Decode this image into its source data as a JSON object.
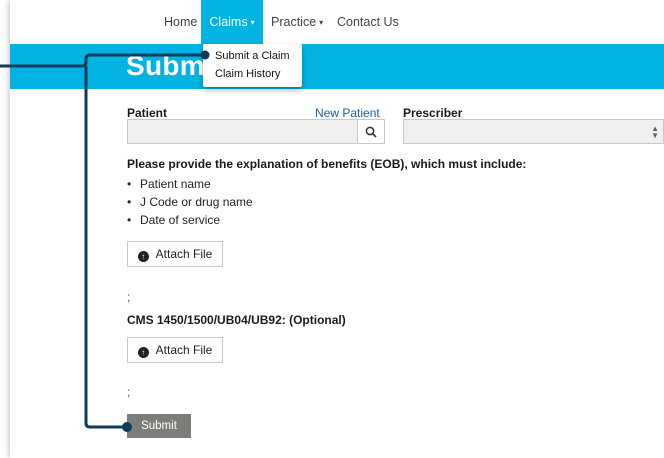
{
  "nav": {
    "home": "Home",
    "claims": "Claims",
    "practice": "Practice",
    "contact": "Contact Us",
    "caret": "▾"
  },
  "banner": {
    "title": "Submit"
  },
  "dropdown": {
    "items": [
      "Submit a Claim",
      "Claim History"
    ]
  },
  "form": {
    "patient_label": "Patient",
    "new_patient_link": "New Patient",
    "prescriber_label": "Prescriber",
    "eob_heading": "Please provide the explanation of benefits (EOB), which must include:",
    "eob_items": [
      "Patient name",
      "J Code or drug name",
      "Date of service"
    ],
    "attach_label": "Attach File",
    "separator": ";",
    "cms_heading": "CMS 1450/1500/UB04/UB92: (Optional)",
    "submit_label": "Submit"
  },
  "colors": {
    "accent": "#00b3e3",
    "connector": "#0e3b5a",
    "submit_bg": "#7d7d7a"
  },
  "icons": {
    "search": "search-icon",
    "upload": "upload-circle-icon"
  }
}
